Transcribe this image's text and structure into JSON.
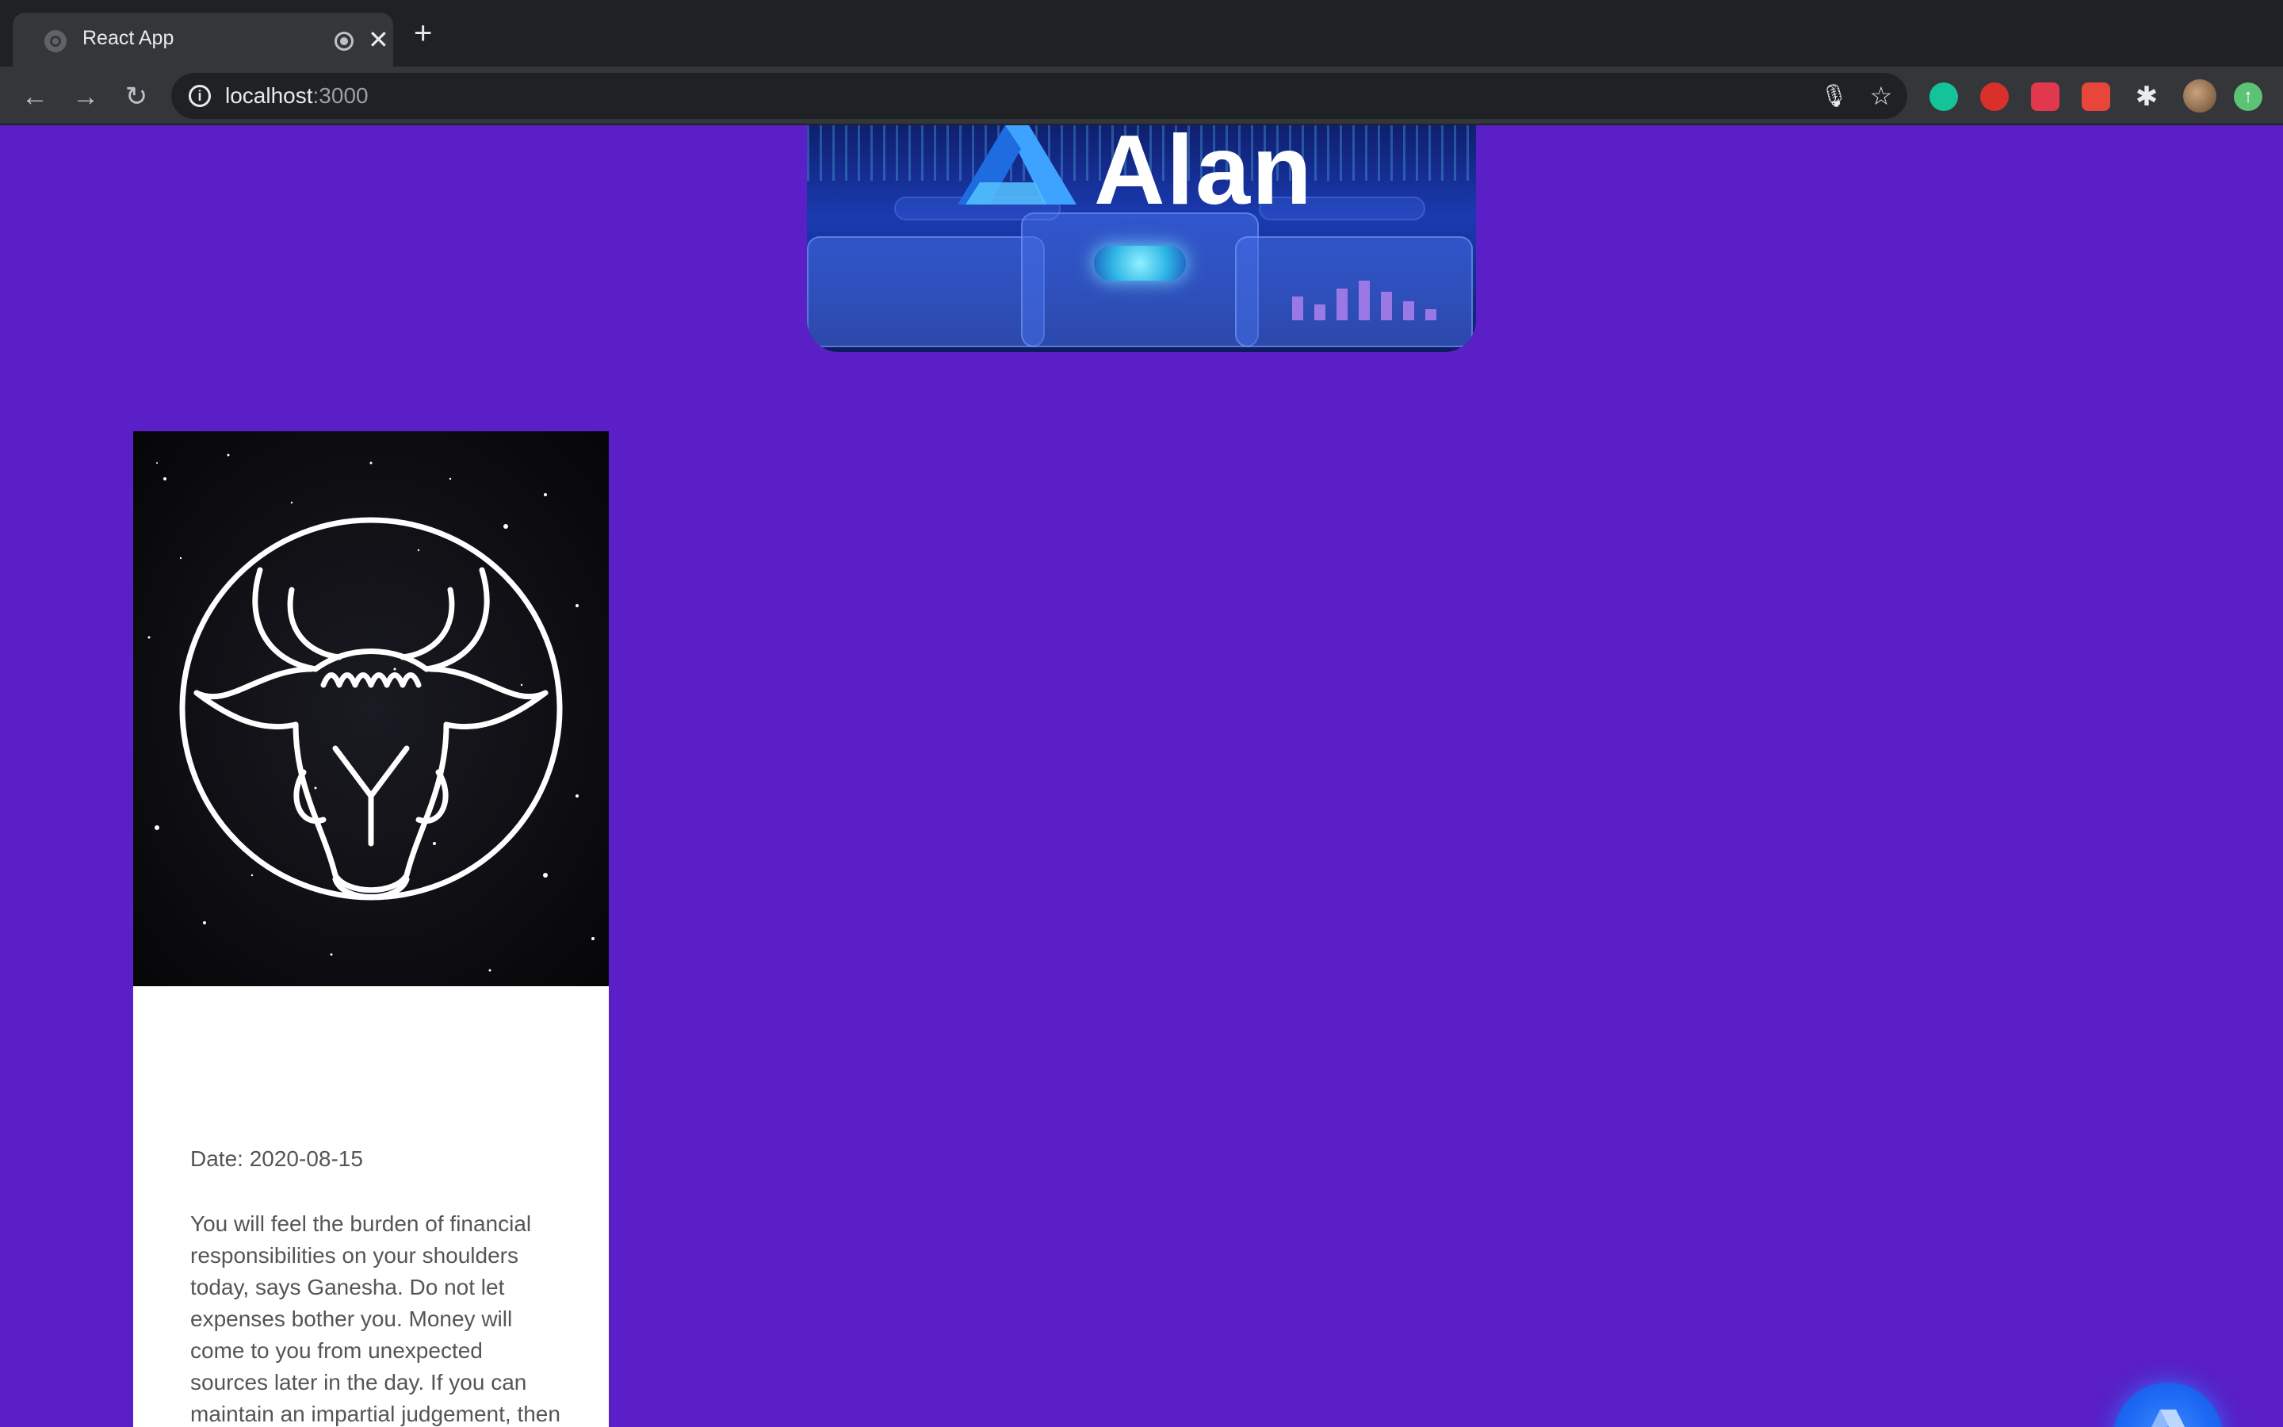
{
  "browser": {
    "tab_title": "React App",
    "new_tab_label": "+",
    "close_label": "✕",
    "url_host": "localhost",
    "url_port": ":3000"
  },
  "banner": {
    "brand": "Alan"
  },
  "card": {
    "date": "Date: 2020-08-15",
    "description": "You will feel the burden of financial responsibilities on your shoulders today, says Ganesha. Do not let expenses bother you. Money will come to you from unexpected sources later in the day. If you can maintain an impartial judgement, then you will yield wonderful results on the financial front, advises Ganesha."
  },
  "colors": {
    "page_background": "#5a1fc6",
    "card_background": "#ffffff",
    "alan_button": "#1e6af5"
  },
  "icons": {
    "back": "arrow-left-icon",
    "forward": "arrow-right-icon",
    "reload": "reload-icon",
    "site_info": "info-icon",
    "mic": "microphone-icon",
    "bookmark": "star-icon",
    "extensions": "puzzle-icon",
    "zodiac": "taurus-bull-icon",
    "alan": "alan-logo-icon"
  }
}
